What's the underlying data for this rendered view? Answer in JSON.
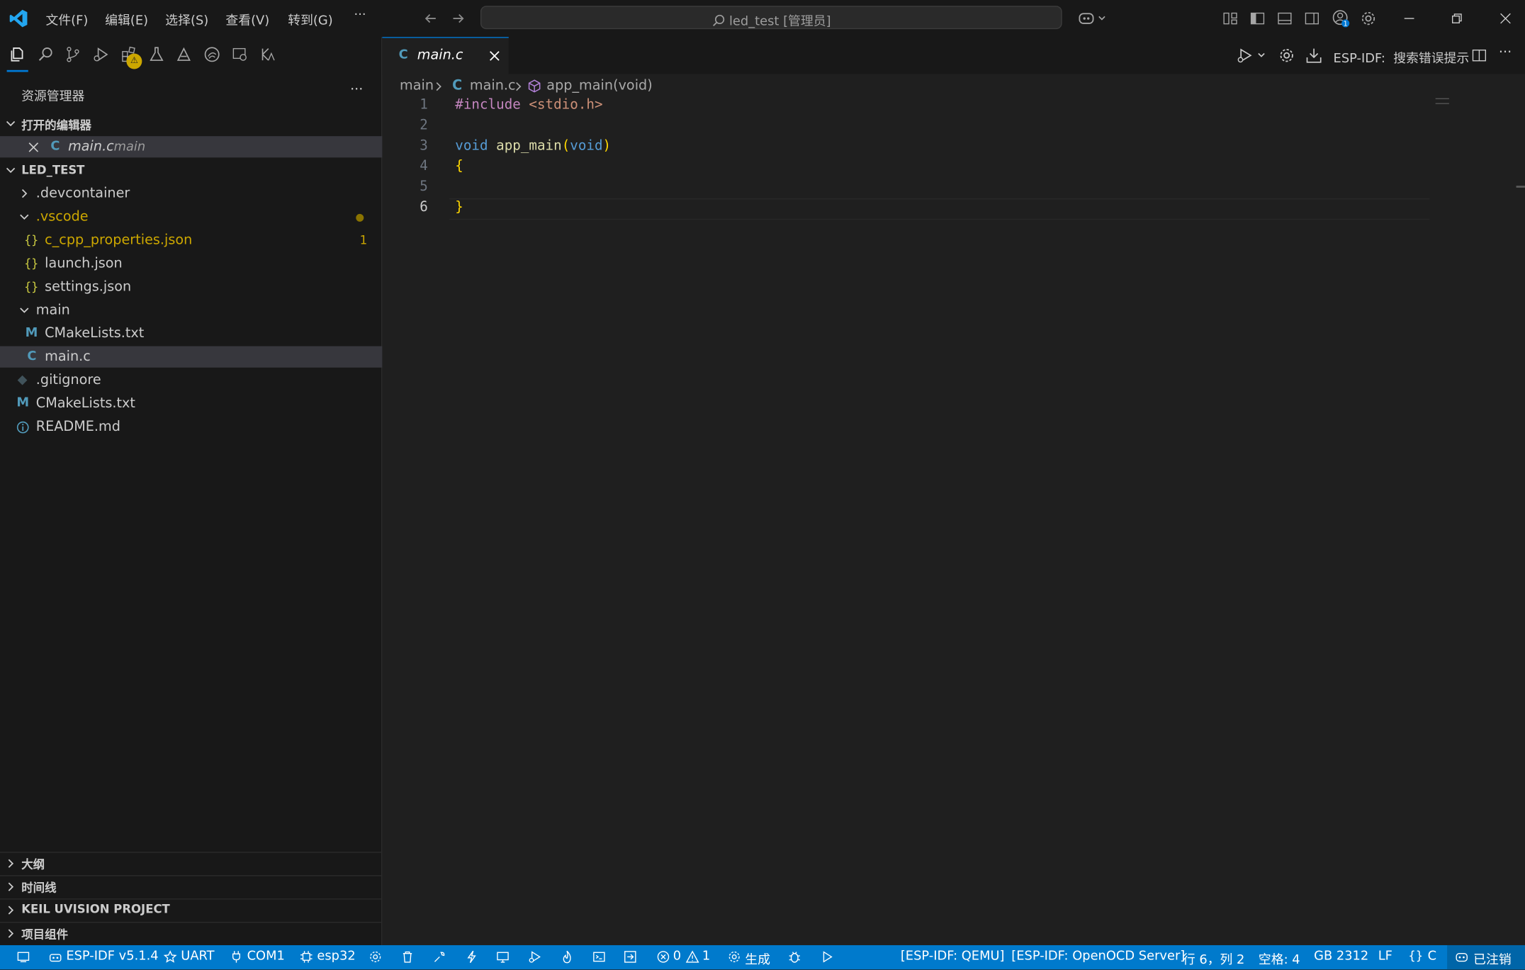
{
  "colors": {
    "accent": "#0078d4",
    "statusbar_bg": "#007acc",
    "modified_yellow": "#cca700",
    "json_icon": "#cbcb41",
    "c_icon": "#519aba",
    "keyword": "#569cd6",
    "function": "#dcdcaa",
    "string": "#ce9178",
    "brace": "#ffd700"
  },
  "titlebar": {
    "menus": [
      "文件(F)",
      "编辑(E)",
      "选择(S)",
      "查看(V)",
      "转到(G)"
    ],
    "more": "···",
    "search_text": "led_test [管理员]"
  },
  "activity_badges": {
    "extensions_warning": "⚠"
  },
  "sidebar": {
    "title": "资源管理器",
    "more": "···",
    "open_editors_header": "打开的编辑器",
    "open_editor_file": "main.c",
    "open_editor_folder": "main",
    "project_header": "LED_TEST",
    "tree": [
      {
        "label": ".devcontainer",
        "icon": "chevron-right"
      },
      {
        "label": ".vscode",
        "icon": "chevron-down"
      },
      {
        "label": "c_cpp_properties.json",
        "icon": "json",
        "badge": "1"
      },
      {
        "label": "launch.json",
        "icon": "json"
      },
      {
        "label": "settings.json",
        "icon": "json"
      },
      {
        "label": "main",
        "icon": "chevron-down"
      },
      {
        "label": "CMakeLists.txt",
        "icon": "cmake"
      },
      {
        "label": "main.c",
        "icon": "c"
      },
      {
        "label": ".gitignore",
        "icon": "git"
      },
      {
        "label": "CMakeLists.txt",
        "icon": "cmake"
      },
      {
        "label": "README.md",
        "icon": "info"
      }
    ],
    "sections": [
      "大纲",
      "时间线",
      "KEIL UVISION PROJECT",
      "项目组件"
    ]
  },
  "editor": {
    "tab_label": "main.c",
    "tab_icon_letter": "C",
    "toolbar_text": "ESP-IDF:  搜索错误提示",
    "breadcrumb": {
      "folder": "main",
      "file": "main.c",
      "symbol": "app_main(void)"
    },
    "line_numbers": [
      "1",
      "2",
      "3",
      "4",
      "5",
      "6"
    ],
    "code": {
      "l1_directive": "#include",
      "l1_header": "<stdio.h>",
      "l3_kw": "void",
      "l3_fn": "app_main",
      "l3_paren_open": "(",
      "l3_param": "void",
      "l3_paren_close": ")",
      "l4": "{",
      "l6": "}"
    }
  },
  "statusbar": {
    "idf_version": "ESP-IDF v5.1.4",
    "uart": "UART",
    "port": "COM1",
    "target": "esp32",
    "errors": "0",
    "warnings": "1",
    "build": "生成",
    "qemu": "[ESP-IDF: QEMU]",
    "openocd": "[ESP-IDF: OpenOCD Server]",
    "position": "行 6，列 2",
    "spaces": "空格: 4",
    "encoding": "GB 2312",
    "eol": "LF",
    "language": "C",
    "account": "已注销"
  }
}
